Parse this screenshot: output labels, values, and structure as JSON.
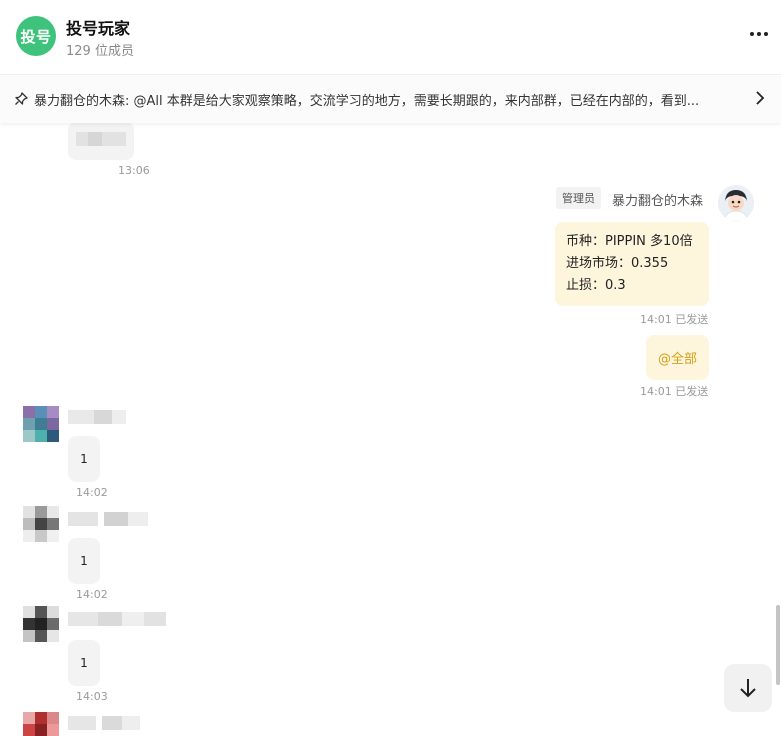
{
  "header": {
    "avatar_text": "投号",
    "group_name": "投号玩家",
    "member_count": "129 位成员"
  },
  "pinned": {
    "text": "暴力翻仓的木森: @All 本群是给大家观察策略，交流学习的地方，需要长期跟的，来内部群，已经在内部的，看到..."
  },
  "messages": {
    "prev_time": "13:06",
    "admin": {
      "role": "管理员",
      "name": "暴力翻仓的木森",
      "line1": "币种：PIPPIN 多10倍",
      "line2": "进场市场：0.355",
      "line3": "止损：0.3",
      "status1": "14:01 已发送",
      "mention": "@全部",
      "status2": "14:01 已发送"
    },
    "replies": [
      {
        "text": "1",
        "time": "14:02"
      },
      {
        "text": "1",
        "time": "14:02"
      },
      {
        "text": "1",
        "time": "14:03"
      }
    ]
  },
  "colors": {
    "avatar_green": "#3ec27c",
    "own_bubble": "#fdf5dc",
    "mention": "#d4a017"
  }
}
